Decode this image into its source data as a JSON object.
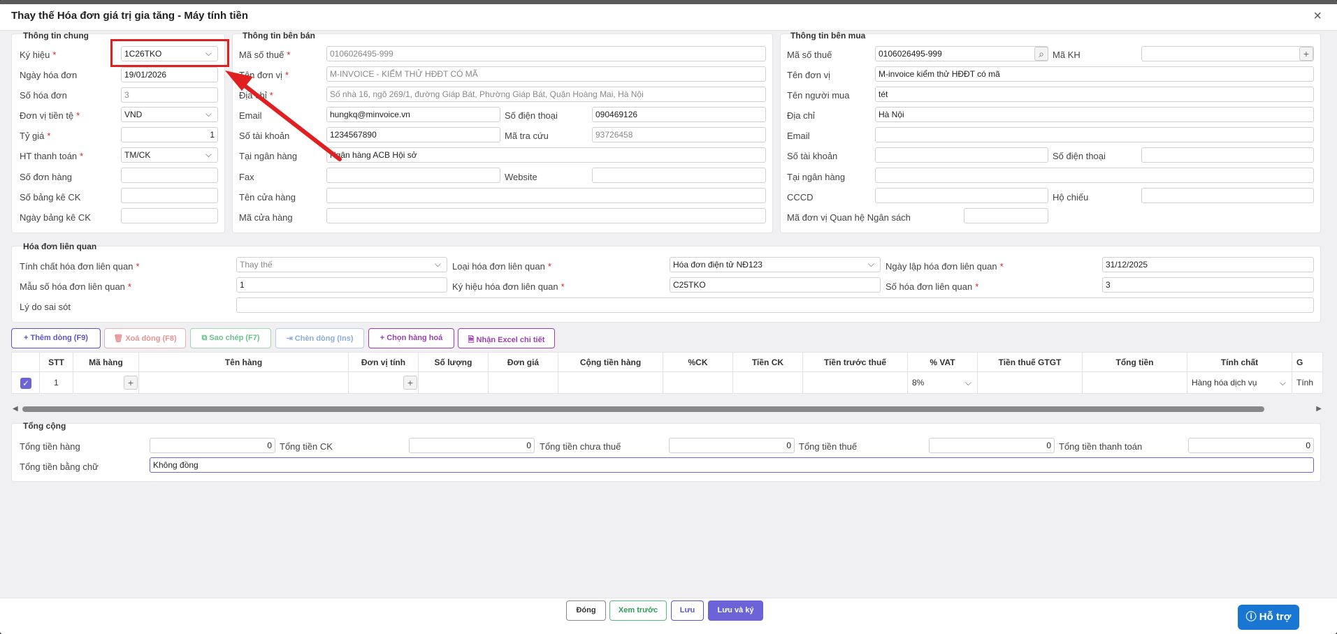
{
  "title": "Thay thế Hóa đơn giá trị gia tăng - Máy tính tiền",
  "general": {
    "title": "Thông tin chung",
    "labels": [
      "Ký hiệu",
      "Ngày hóa đơn",
      "Số hóa đơn",
      "Đơn vị tiền tệ",
      "Tỷ giá",
      "HT thanh toán",
      "Số đơn hàng",
      "Số bảng kê CK",
      "Ngày bảng kê CK"
    ],
    "kyhieu": "1C26TKO",
    "ngay": "19/01/2026",
    "so": "3",
    "tiente": "VND",
    "tygia": "1",
    "httt": "TM/CK"
  },
  "seller": {
    "title": "Thông tin bên bán",
    "labels": [
      "Mã số thuế",
      "Tên đơn vị",
      "Địa chỉ",
      "Email",
      "Số tài khoản",
      "Tại ngân hàng",
      "Fax",
      "Tên cửa hàng",
      "Mã cửa hàng"
    ],
    "label_phone": "Số điện thoại",
    "label_lookup": "Mã tra cứu",
    "label_website": "Website",
    "mst": "0106026495-999",
    "ten": "M-INVOICE - KIỂM THỬ HĐĐT CÓ MÃ",
    "diachi": "Số nhà 16, ngõ 269/1, đường Giáp Bát, Phường Giáp Bát, Quận Hoàng Mai, Hà Nội",
    "email": "hungkq@minvoice.vn",
    "phone": "090469126",
    "stk": "1234567890",
    "lookup": "93726458",
    "bank": "Ngân hàng ACB Hội sở"
  },
  "buyer": {
    "title": "Thông tin bên mua",
    "labels": [
      "Mã số thuế",
      "Tên đơn vị",
      "Tên người mua",
      "Địa chỉ",
      "Email",
      "Số tài khoản",
      "Tại ngân hàng",
      "CCCD",
      "Mã đơn vị Quan hệ Ngân sách"
    ],
    "label_makh": "Mã KH",
    "label_phone": "Số điện thoại",
    "label_passport": "Hộ chiếu",
    "mst": "0106026495-999",
    "ten": "M-invoice kiểm thử HĐĐT có mã",
    "nguoimua": "tét",
    "diachi": "Hà Nội"
  },
  "related": {
    "title": "Hóa đơn liên quan",
    "label_tinhchat": "Tính chất hóa đơn liên quan",
    "label_mau": "Mẫu số hóa đơn liên quan",
    "label_lydo": "Lý do sai sót",
    "label_loai": "Loại hóa đơn liên quan",
    "label_kyhieu": "Ký hiệu hóa đơn liên quan",
    "label_ngay": "Ngày lập hóa đơn liên quan",
    "label_so": "Số hóa đơn liên quan",
    "tinhchat": "Thay thế",
    "mau": "1",
    "loai": "Hóa đơn điện tử NĐ123",
    "kyhieu": "C25TKO",
    "ngay": "31/12/2025",
    "so": "3"
  },
  "toolbar": {
    "add": "Thêm dòng (F9)",
    "delete": "Xoá dòng (F8)",
    "copy": "Sao chép (F7)",
    "insert": "Chèn dòng (Ins)",
    "choose": "Chọn hàng hoá",
    "excel": "Nhận Excel chi tiết"
  },
  "grid": {
    "headers": [
      "STT",
      "Mã hàng",
      "Tên hàng",
      "Đơn vị tính",
      "Số lượng",
      "Đơn giá",
      "Cộng tiền hàng",
      "%CK",
      "Tiền CK",
      "Tiền trước thuế",
      "% VAT",
      "Tiền thuế GTGT",
      "Tổng tiền",
      "Tính chất",
      "G"
    ],
    "row": {
      "stt": "1",
      "vat": "8%",
      "tinhchat": "Hàng hóa dịch vụ",
      "extra": "Tính"
    }
  },
  "totals": {
    "title": "Tổng cộng",
    "labels": [
      "Tổng tiền hàng",
      "Tổng tiền CK",
      "Tổng tiền chưa thuế",
      "Tổng tiền thuế",
      "Tổng tiền thanh toán"
    ],
    "values": [
      "0",
      "0",
      "0",
      "0",
      "0"
    ],
    "label_words": "Tổng tiền bằng chữ",
    "words": "Không đồng"
  },
  "footer": {
    "close": "Đóng",
    "preview": "Xem trước",
    "save": "Lưu",
    "save_sign": "Lưu và ký"
  },
  "help": "Hỗ trợ",
  "colors": {
    "accent": "#6c63d9",
    "annotation": "#e02020"
  }
}
